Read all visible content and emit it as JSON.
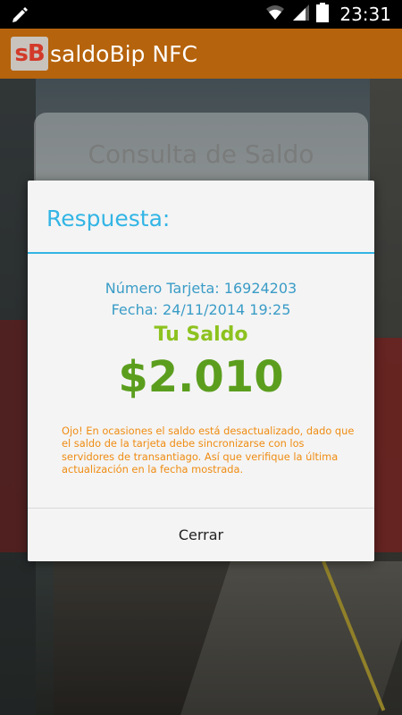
{
  "status_bar": {
    "time": "23:31",
    "icons": [
      "edit-pencil-icon",
      "wifi-icon",
      "signal-icon",
      "battery-icon"
    ]
  },
  "app_bar": {
    "logo_text": "sB",
    "title": "saldoBip NFC",
    "color": "#b5630c"
  },
  "background_card": {
    "title": "Consulta de Saldo"
  },
  "dialog": {
    "title": "Respuesta:",
    "card_number_line": "Número Tarjeta: 16924203",
    "date_line": "Fecha: 24/11/2014 19:25",
    "balance_label": "Tu Saldo",
    "balance_amount": "$2.010",
    "warning": "Ojo! En ocasiones el saldo está desactualizado, dado que el saldo de la tarjeta debe sincronizarse con los servidores de transantiago. Así que verifique la última actualización en la fecha mostrada.",
    "close_button": "Cerrar",
    "accent_color": "#33b5e5",
    "balance_color": "#5b9e1e",
    "warning_color": "#ef8c12"
  }
}
